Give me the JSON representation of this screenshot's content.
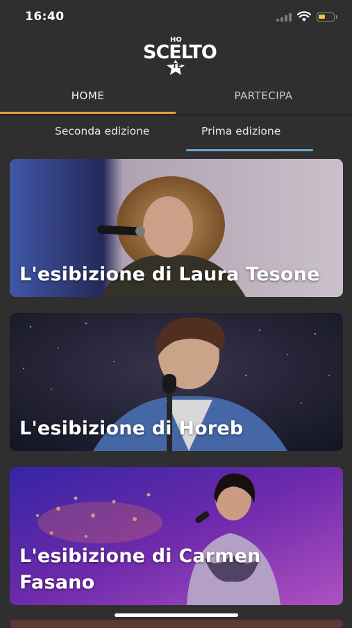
{
  "status_bar": {
    "time": "16:40"
  },
  "app": {
    "logo": {
      "top": "HO",
      "main": "SCELTO",
      "bottom": "TE"
    }
  },
  "main_tabs": [
    {
      "label": "HOME",
      "selected": true
    },
    {
      "label": "PARTECIPA",
      "selected": false
    }
  ],
  "sub_tabs": [
    {
      "label": "Seconda edizione",
      "selected": false
    },
    {
      "label": "Prima edizione",
      "selected": true
    }
  ],
  "videos": [
    {
      "title": "L'esibizione di Laura Tesone"
    },
    {
      "title": "L'esibizione di Horeb"
    },
    {
      "title": "L'esibizione di Carmen Fasano"
    }
  ],
  "colors": {
    "background": "#2f2f2f",
    "home_underline": "#e6a23c",
    "edition_underline": "#6fa7cc",
    "battery": "#f2c531"
  }
}
